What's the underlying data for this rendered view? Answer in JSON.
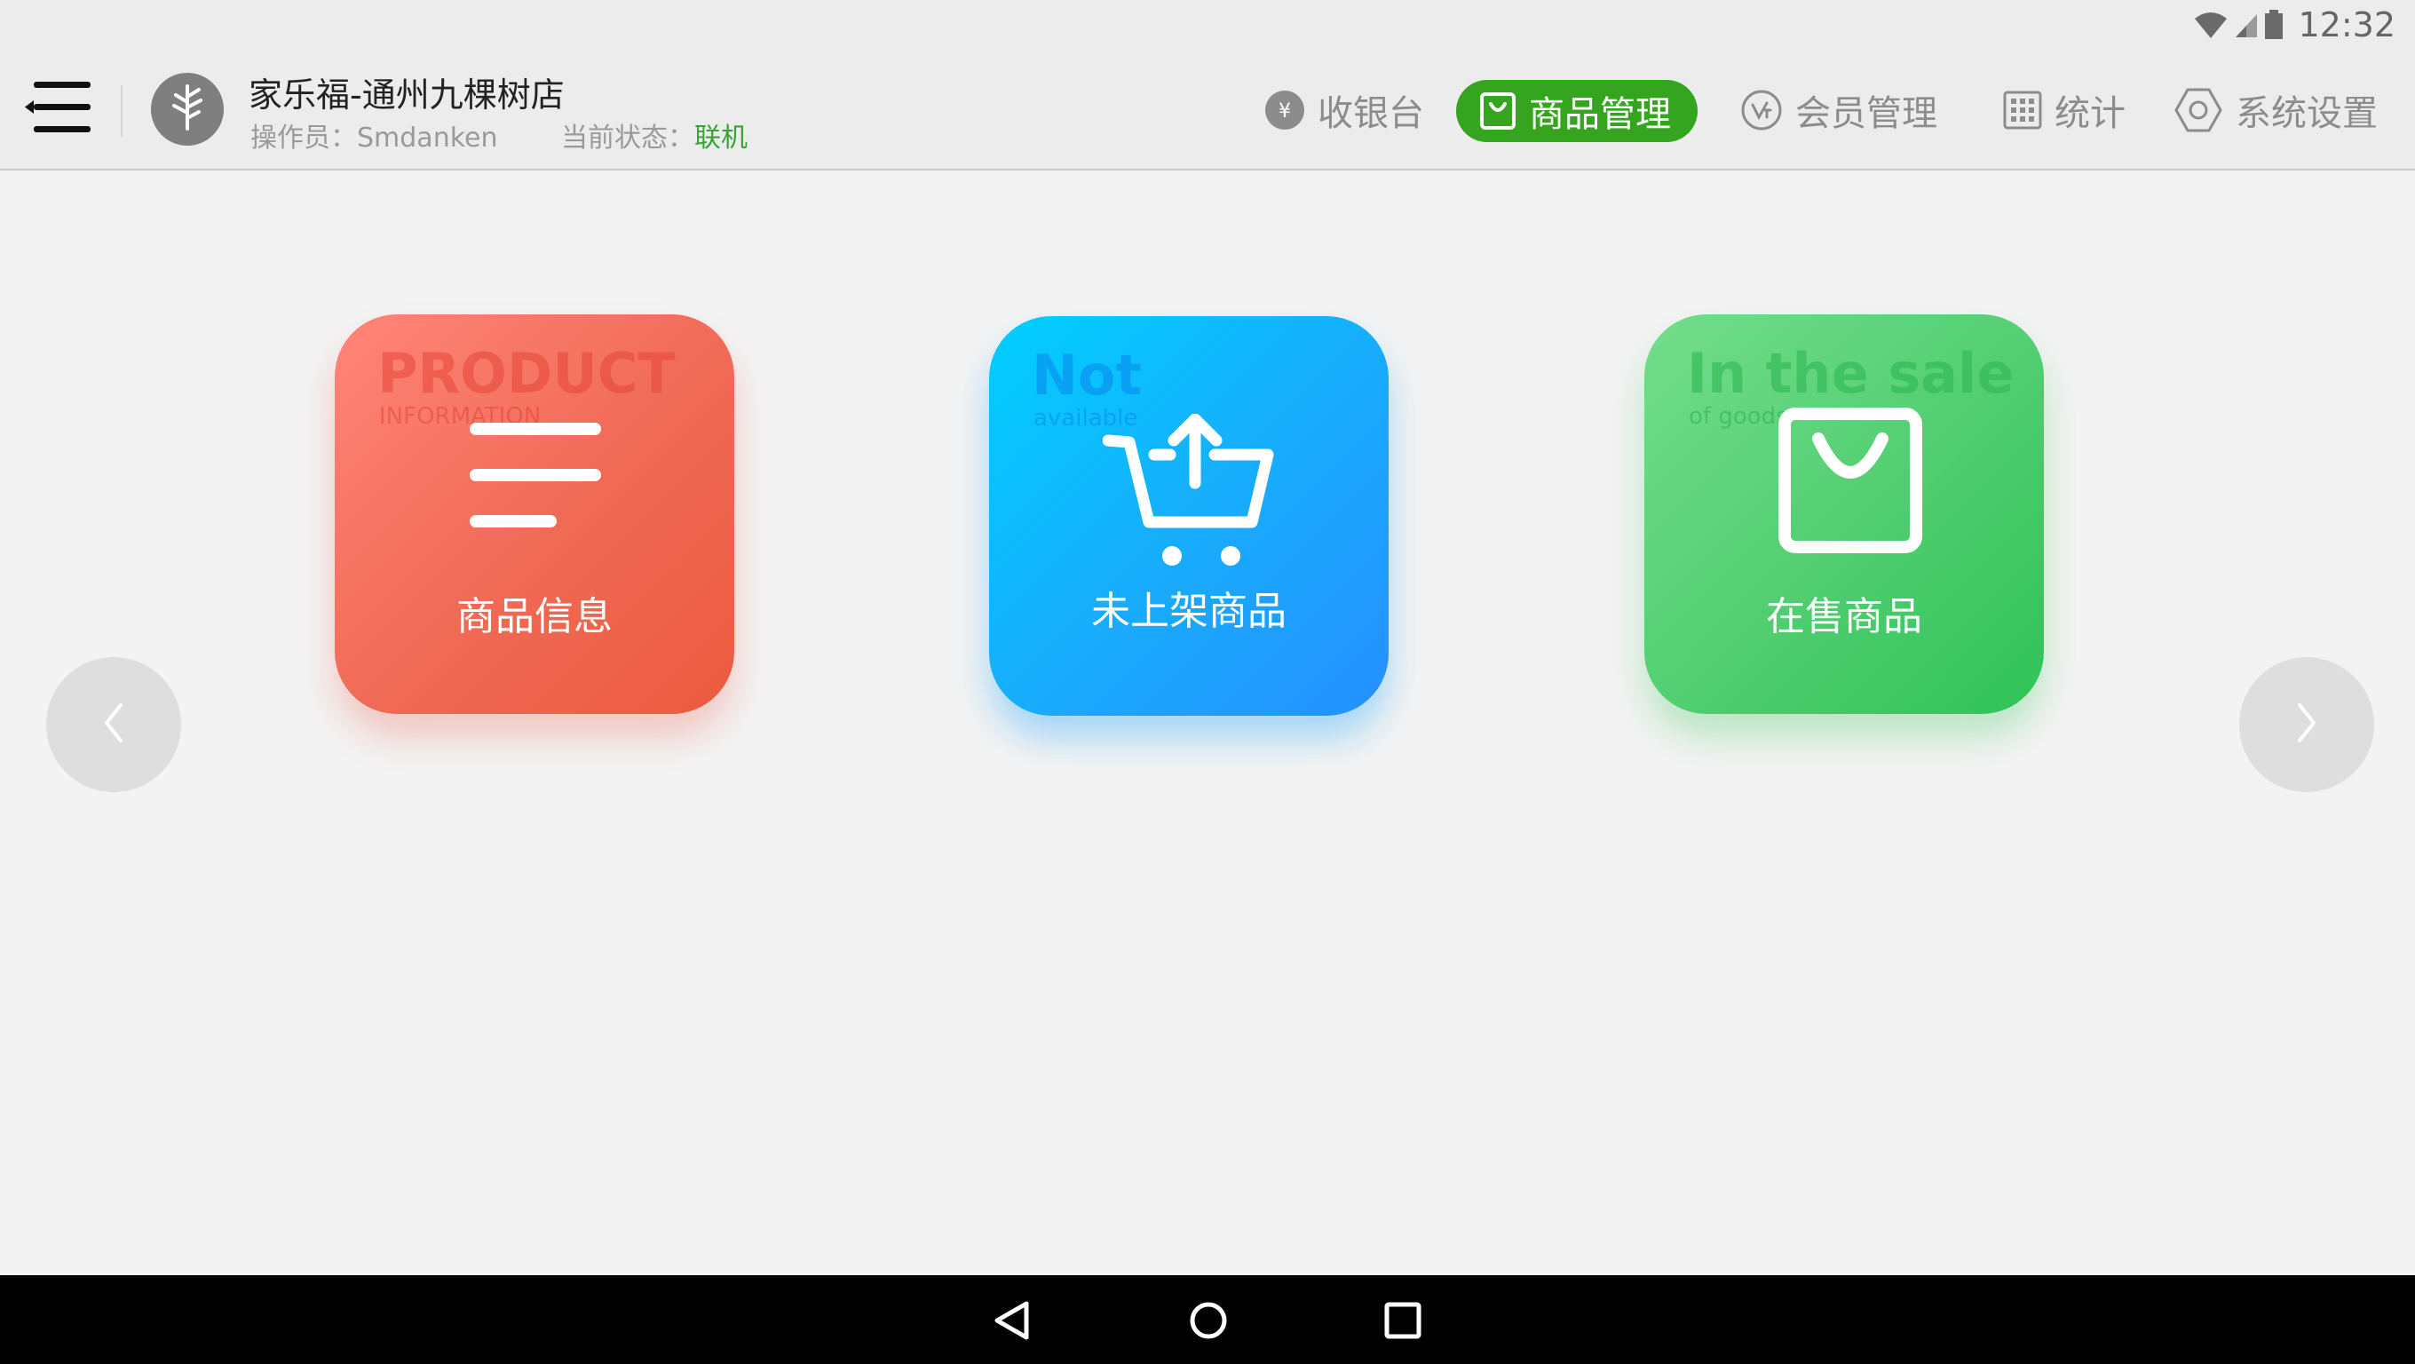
{
  "status_bar": {
    "time": "12:32",
    "icons": [
      "wifi-icon",
      "cell-signal-icon",
      "battery-icon"
    ]
  },
  "header": {
    "store_name": "家乐福-通州九棵树店",
    "operator_label": "操作员：",
    "operator_name": "Smdanken",
    "status_label": "当前状态：",
    "status_value": "联机",
    "status_color": "#3aa336"
  },
  "nav": {
    "items": [
      {
        "label": "收银台",
        "icon": "yen-coin-icon",
        "active": false
      },
      {
        "label": "商品管理",
        "icon": "shopping-bag-icon",
        "active": true
      },
      {
        "label": "会员管理",
        "icon": "vip-badge-icon",
        "active": false
      },
      {
        "label": "统计",
        "icon": "grid-icon",
        "active": false
      },
      {
        "label": "系统设置",
        "icon": "gear-icon",
        "active": false
      }
    ],
    "active_color": "#35a520"
  },
  "cards": [
    {
      "label": "商品信息",
      "watermark": "PRODUCT",
      "watermark_sub": "INFORMATION",
      "icon": "list-icon",
      "color": "#f06a55"
    },
    {
      "label": "未上架商品",
      "watermark": "Not",
      "watermark_sub": "available",
      "icon": "cart-upload-icon",
      "color": "#17aefc"
    },
    {
      "label": "在售商品",
      "watermark": "In the sale",
      "watermark_sub": "of goods",
      "icon": "shopping-bag-icon",
      "color": "#54cf73"
    }
  ],
  "carousel": {
    "prev_icon": "chevron-left-icon",
    "next_icon": "chevron-right-icon"
  },
  "android_nav": {
    "icons": [
      "back-icon",
      "home-icon",
      "recents-icon"
    ]
  }
}
